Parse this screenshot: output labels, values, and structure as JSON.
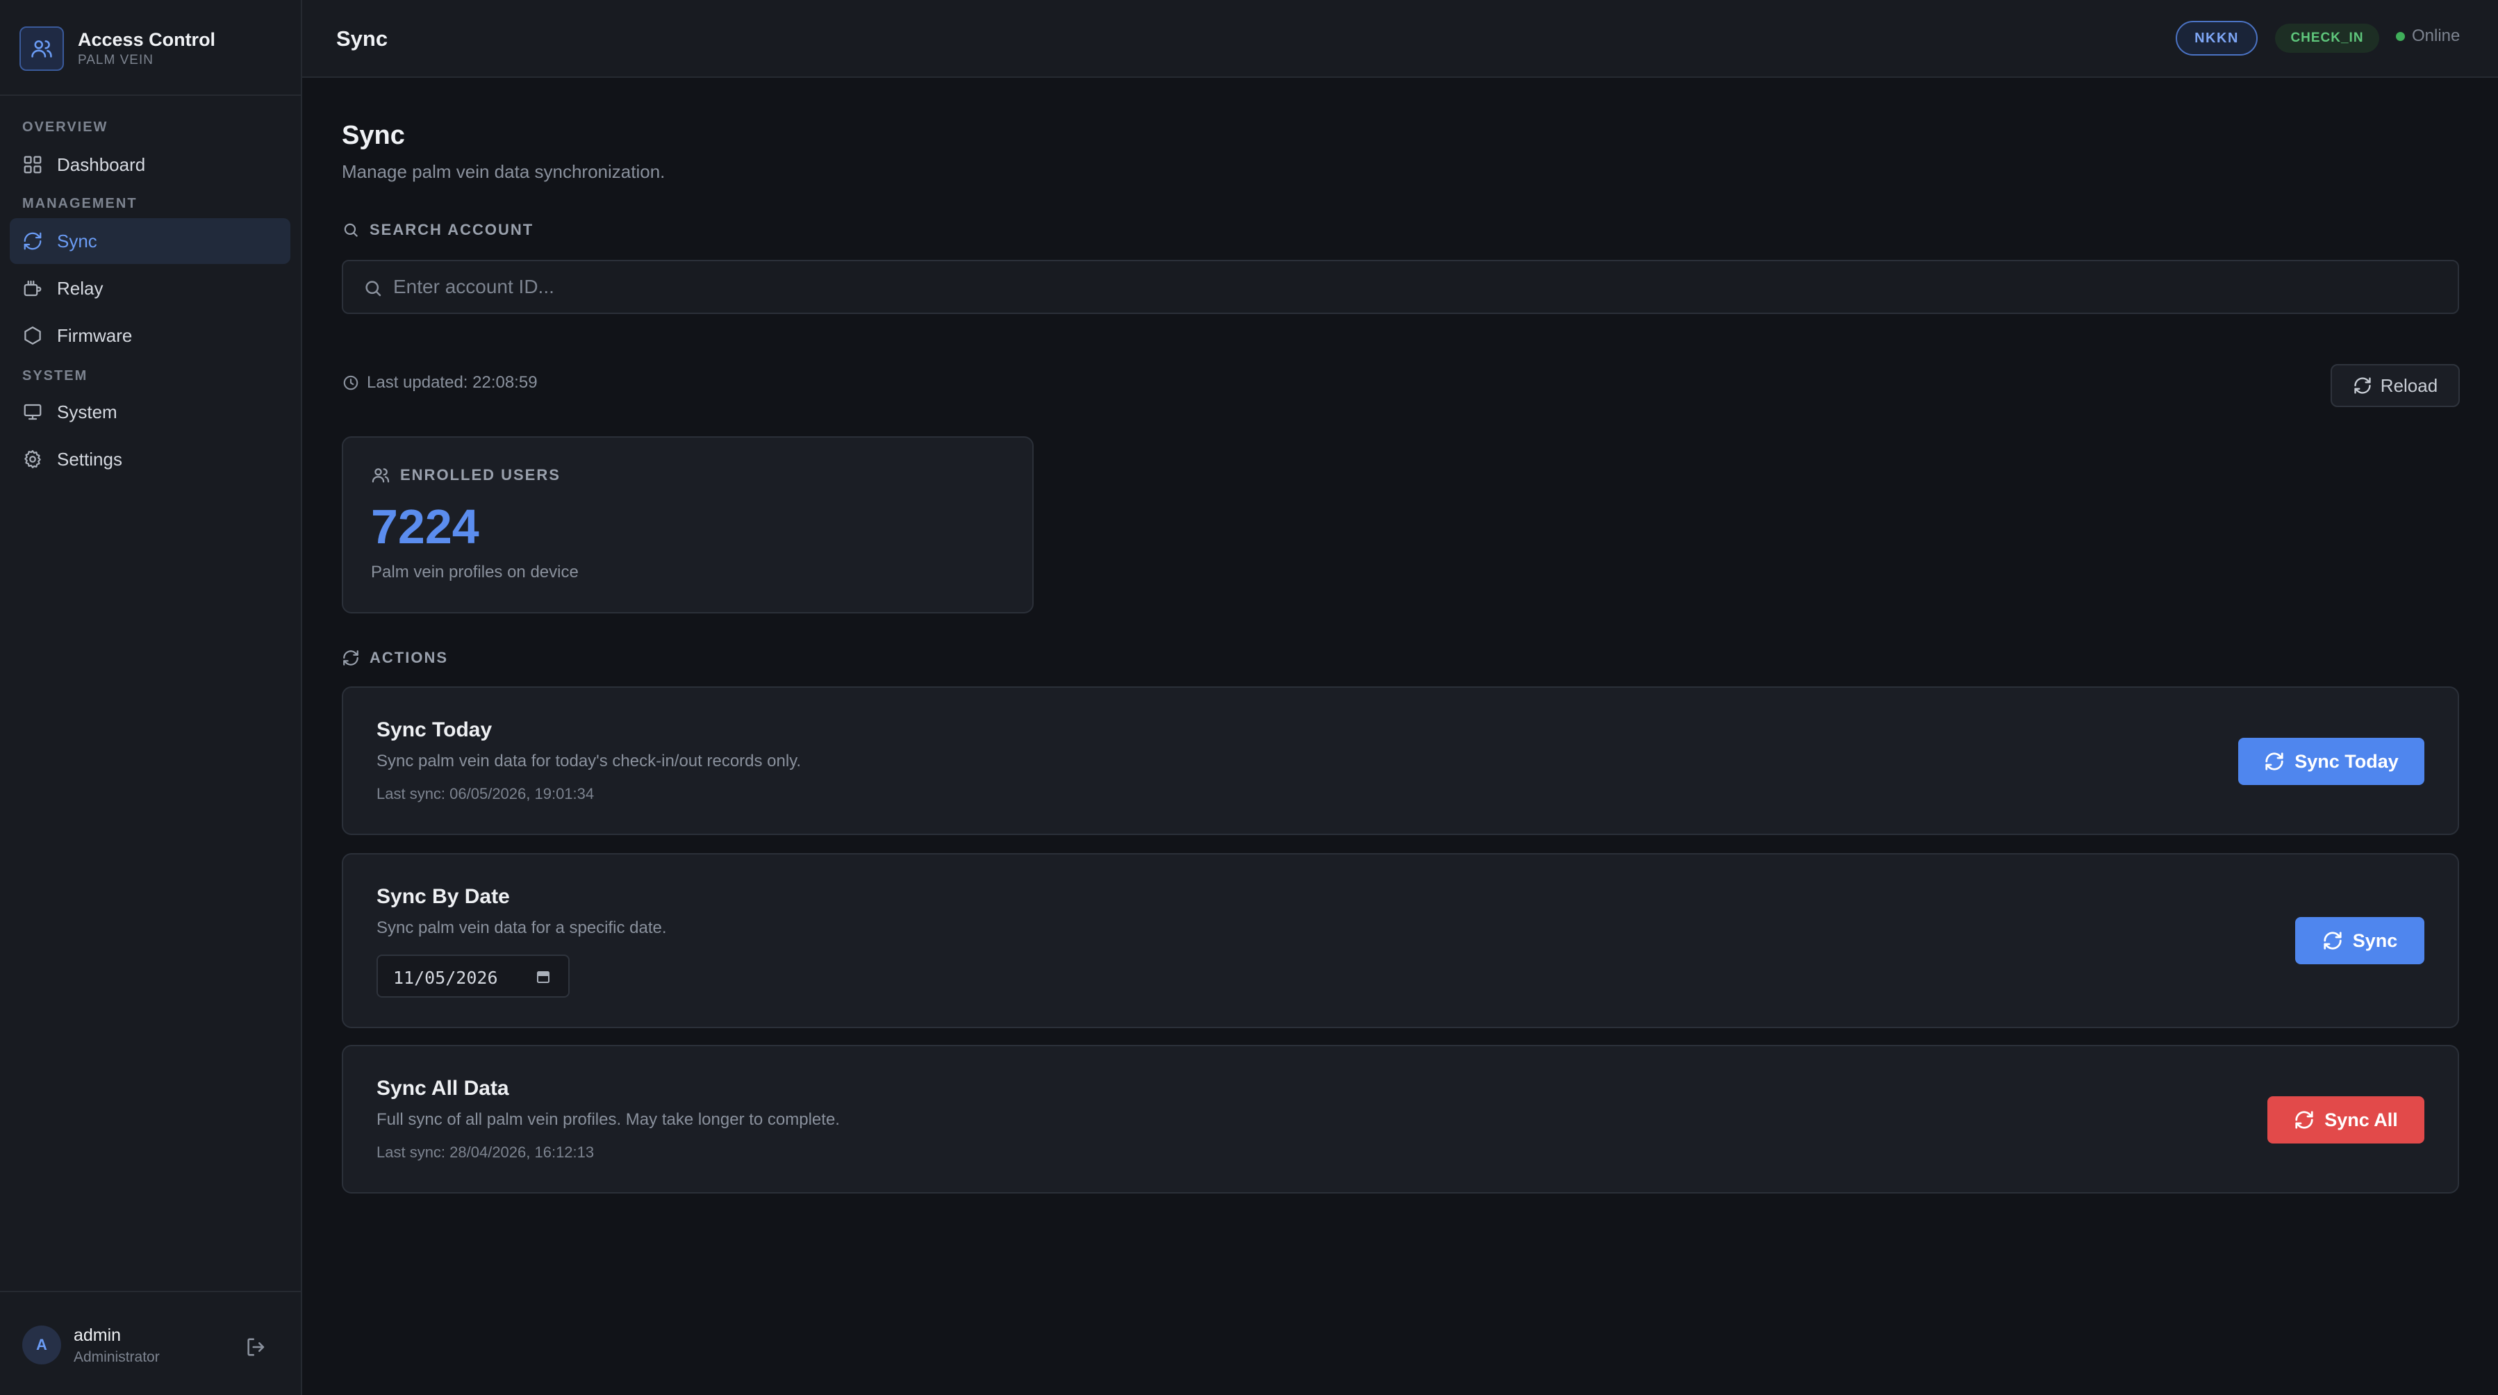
{
  "brand": {
    "title": "Access Control",
    "subtitle": "PALM VEIN"
  },
  "sidebar": {
    "sections": [
      "OVERVIEW",
      "MANAGEMENT",
      "SYSTEM"
    ],
    "items": [
      {
        "label": "Dashboard",
        "icon": "grid-icon"
      },
      {
        "label": "Sync",
        "icon": "refresh-icon",
        "active": true
      },
      {
        "label": "Relay",
        "icon": "relay-icon"
      },
      {
        "label": "Firmware",
        "icon": "hexagon-icon"
      },
      {
        "label": "System",
        "icon": "monitor-icon"
      },
      {
        "label": "Settings",
        "icon": "gear-icon"
      }
    ]
  },
  "user": {
    "initial": "A",
    "name": "admin",
    "role": "Administrator"
  },
  "topbar": {
    "title": "Sync",
    "badge_device": "NKKN",
    "badge_mode": "CHECK_IN",
    "status": "Online"
  },
  "page": {
    "title": "Sync",
    "subtitle": "Manage palm vein data synchronization."
  },
  "search": {
    "label": "SEARCH ACCOUNT",
    "placeholder": "Enter account ID..."
  },
  "last_updated": "Last updated: 22:08:59",
  "reload_label": "Reload",
  "stats": {
    "label": "ENROLLED USERS",
    "value": "7224",
    "description": "Palm vein profiles on device"
  },
  "actions_label": "ACTIONS",
  "actions": [
    {
      "title": "Sync Today",
      "description": "Sync palm vein data for today's check-in/out records only.",
      "meta": "Last sync: 06/05/2026, 19:01:34",
      "button": "Sync Today"
    },
    {
      "title": "Sync By Date",
      "description": "Sync palm vein data for a specific date.",
      "date_value": "11/05/2026",
      "button": "Sync"
    },
    {
      "title": "Sync All Data",
      "description": "Full sync of all palm vein profiles. May take longer to complete.",
      "meta": "Last sync: 28/04/2026, 16:12:13",
      "button": "Sync All"
    }
  ],
  "colors": {
    "accent": "#4f86ee",
    "danger": "#e24a4a",
    "online": "#3fae5a",
    "background": "#111318"
  }
}
